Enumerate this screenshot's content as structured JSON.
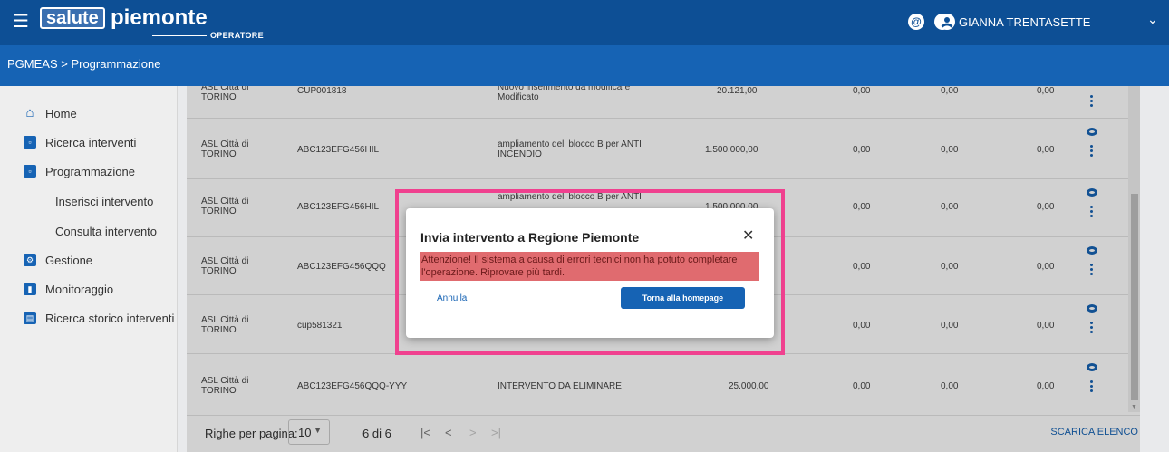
{
  "header": {
    "logo_box": "salute",
    "logo_word": "piemonte",
    "logo_sub": "OPERATORE",
    "at_symbol": "@",
    "help_symbol": "?",
    "user_name": "GIANNA TRENTASETTE",
    "chevron": "⌄"
  },
  "breadcrumb": "PGMEAS > Programmazione",
  "sidebar": {
    "items": [
      {
        "label": "Home",
        "icon": "home-icon"
      },
      {
        "label": "Ricerca interventi",
        "icon": "calendar-icon"
      },
      {
        "label": "Programmazione",
        "icon": "calendar-icon"
      },
      {
        "label": "Inserisci intervento"
      },
      {
        "label": "Consulta intervento"
      },
      {
        "label": "Gestione",
        "icon": "settings-box-icon"
      },
      {
        "label": "Monitoraggio",
        "icon": "bar-chart-icon"
      },
      {
        "label": "Ricerca storico interventi",
        "icon": "archive-icon"
      }
    ]
  },
  "table": {
    "rows": [
      {
        "asl": "ASL Città di TORINO",
        "cup": "CUP001818",
        "desc": "Nuovo inserimento da modificare Modificato",
        "v1": "20.121,00",
        "v2": "0,00",
        "v3": "0,00",
        "v4": "0,00"
      },
      {
        "asl": "ASL Città di TORINO",
        "cup": "ABC123EFG456HIL",
        "desc": "ampliamento dell blocco B per ANTI INCENDIO",
        "v1": "1.500.000,00",
        "v2": "0,00",
        "v3": "0,00",
        "v4": "0,00"
      },
      {
        "asl": "ASL Città di TORINO",
        "cup": "ABC123EFG456HIL",
        "desc": "ampliamento dell blocco B per ANTI",
        "v1": "1.500.000,00",
        "v2": "0,00",
        "v3": "0,00",
        "v4": "0,00"
      },
      {
        "asl": "ASL Città di TORINO",
        "cup": "ABC123EFG456QQQ",
        "desc": "",
        "v1": "",
        "v2": "0,00",
        "v3": "0,00",
        "v4": "0,00"
      },
      {
        "asl": "ASL Città di TORINO",
        "cup": "cup581321",
        "desc": "",
        "v1": "",
        "v2": "0,00",
        "v3": "0,00",
        "v4": "0,00"
      },
      {
        "asl": "ASL Città di TORINO",
        "cup": "ABC123EFG456QQQ-YYY",
        "desc": "INTERVENTO DA ELIMINARE",
        "v1": "25.000,00",
        "v2": "0,00",
        "v3": "0,00",
        "v4": "0,00"
      }
    ]
  },
  "footer": {
    "rows_per_page_label": "Righe per pagina:",
    "rows_per_page_value": "10",
    "page_info": "6 di 6",
    "first": "|<",
    "prev": "<",
    "next": ">",
    "last": ">|",
    "download": "SCARICA ELENCO"
  },
  "modal": {
    "title": "Invia intervento a Regione Piemonte",
    "close": "✕",
    "alert": "Attenzione! Il sistema a causa di errori tecnici non ha potuto completare l'operazione. Riprovare più tardi.",
    "cancel": "Annulla",
    "primary": "Torna alla homepage"
  },
  "colors": {
    "header": "#0d4f95",
    "breadcrumb_bar": "#1663b4",
    "alert_bg": "#e06b6f",
    "highlight": "#f0418f"
  }
}
